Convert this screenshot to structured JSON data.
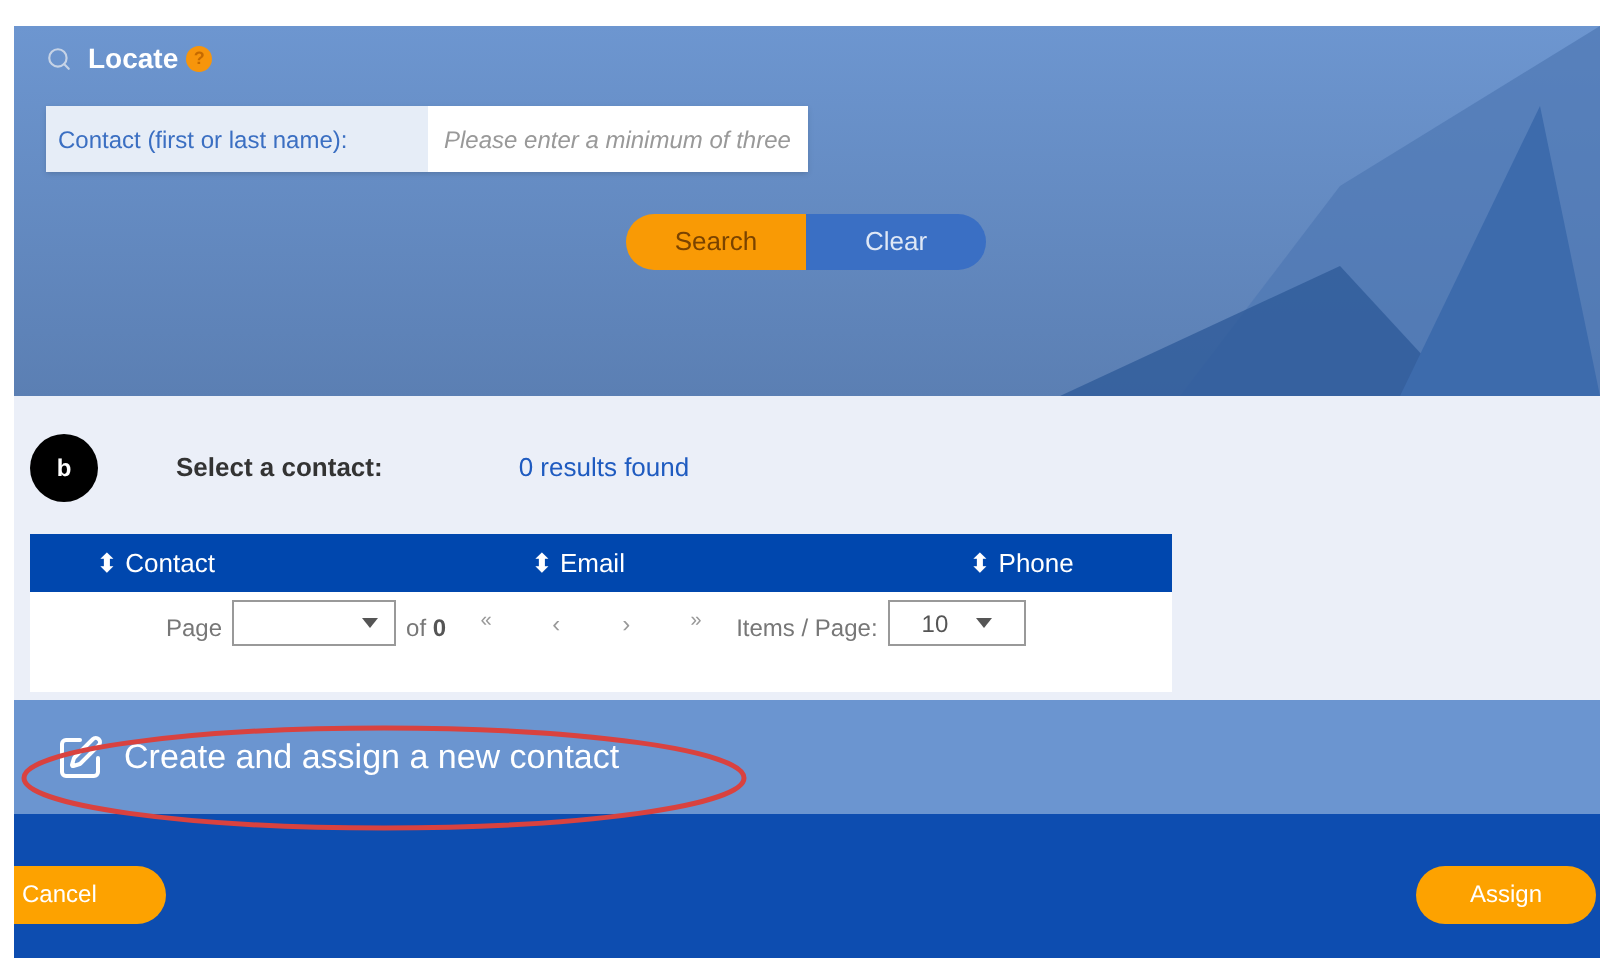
{
  "locate": {
    "title": "Locate",
    "help": "?"
  },
  "contact_field": {
    "label": "Contact (first or last name):",
    "placeholder": "Please enter a minimum of three"
  },
  "buttons": [
    {
      "label": "Search",
      "selected": true
    },
    {
      "label": "Clear",
      "selected": false
    }
  ],
  "results": {
    "badge": "b",
    "label": "Select a contact:",
    "count": "0 results found"
  },
  "table": {
    "columns": [
      {
        "label": "Contact",
        "sort": "⬍"
      },
      {
        "label": "Email",
        "sort": "⬍"
      },
      {
        "label": "Phone",
        "sort": "⬍"
      }
    ],
    "pager": {
      "page_label": "Page",
      "of": "of",
      "total": "0",
      "nav": [
        "«",
        "‹",
        "›",
        "»"
      ],
      "items_label": "Items / Page:",
      "items_value": "10"
    }
  },
  "create_link": {
    "label": "Create and assign a new contact",
    "highlighted": true
  },
  "footer": {
    "cancel": "Cancel",
    "assign": "Assign"
  }
}
